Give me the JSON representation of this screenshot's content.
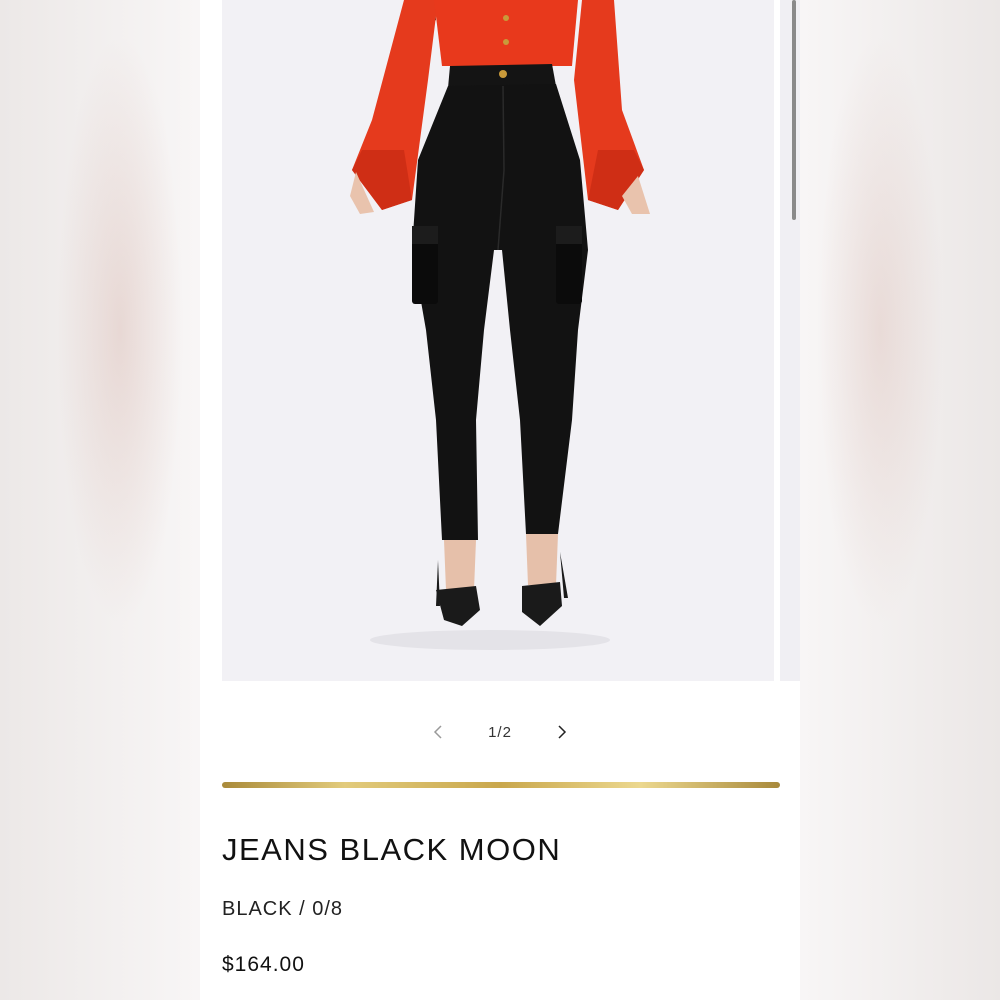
{
  "product": {
    "title": "JEANS BLACK MOON",
    "variant": "BLACK / 0/8",
    "price": "$164.00",
    "image_alt": "Model wearing high-waisted black cargo skinny jeans with red blouse and black pointed heels"
  },
  "gallery": {
    "counter": "1/2",
    "prev_icon": "chevron-left-icon",
    "next_icon": "chevron-right-icon"
  },
  "colors": {
    "gold_accent": "#c9a74c",
    "blouse": "#e8391c",
    "jeans": "#121212",
    "photo_background": "#f2f1f5"
  }
}
